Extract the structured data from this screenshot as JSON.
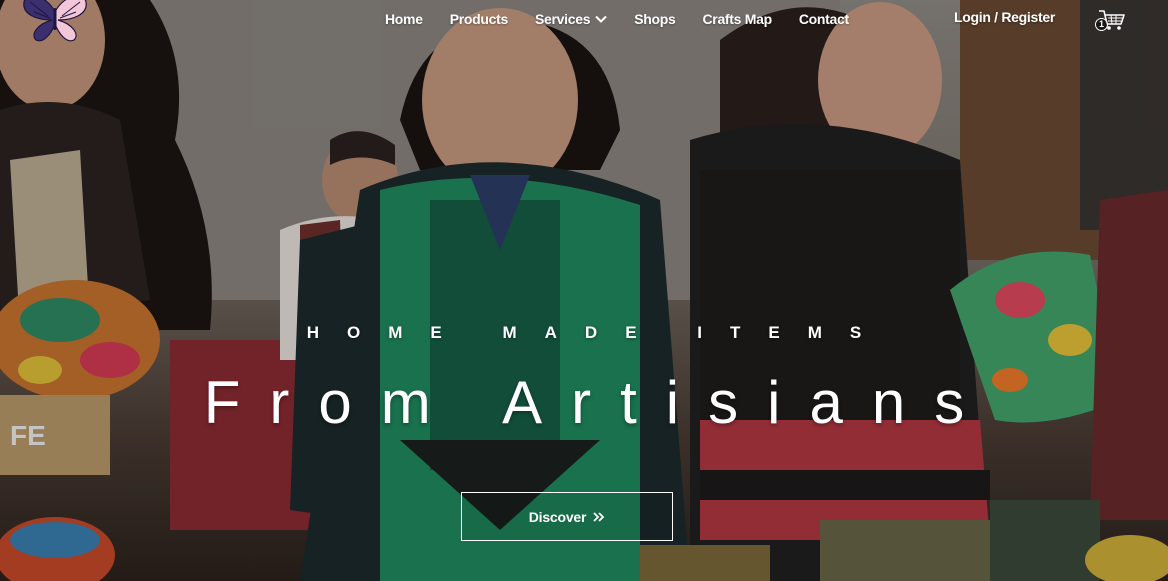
{
  "nav": {
    "items": [
      {
        "label": "Home"
      },
      {
        "label": "Products"
      },
      {
        "label": "Services"
      },
      {
        "label": "Shops"
      },
      {
        "label": "Crafts Map"
      },
      {
        "label": "Contact"
      }
    ],
    "login_label": "Login / Register",
    "cart_count": "1"
  },
  "hero": {
    "subtitle": "HOME MADE ITEMS",
    "title": "From Artisians",
    "button_label": "Discover",
    "button_icon": "double-chevron-right-icon"
  },
  "logo": {
    "icon": "butterfly-icon"
  },
  "colors": {
    "text": "#ffffff",
    "accent_green": "#1f8a5f"
  }
}
